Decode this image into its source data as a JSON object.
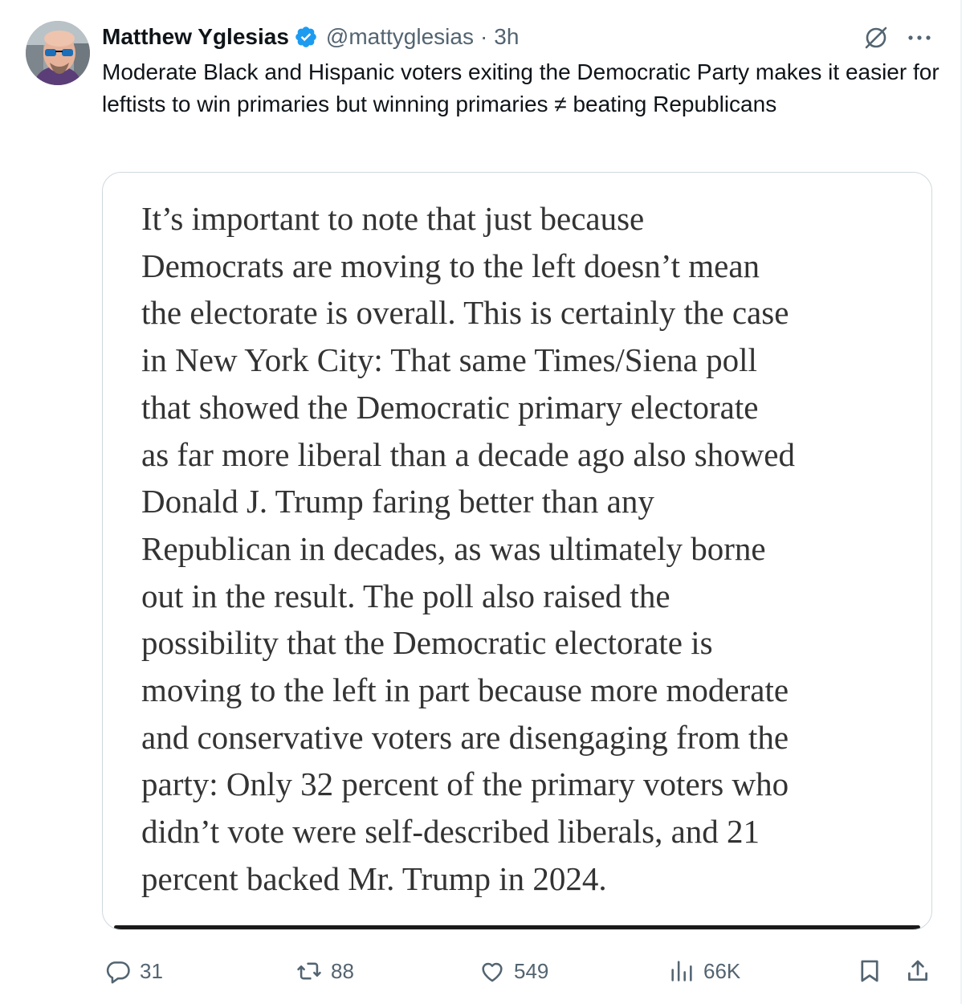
{
  "tweet": {
    "author": {
      "display_name": "Matthew Yglesias",
      "handle": "@mattyglesias",
      "verified": true,
      "avatar_icon": "avatar-photo"
    },
    "separator": "·",
    "time": "3h",
    "text": "Moderate Black and Hispanic voters exiting the Democratic Party makes it easier for leftists to win primaries but winning primaries ≠ beating Republicans",
    "media": {
      "quote_lines": [
        "It’s important to note that just because",
        "Democrats are moving to the left doesn’t mean",
        "the electorate is overall. This is certainly the case",
        "in New York City: That same Times/Siena poll",
        "that showed the Democratic primary electorate",
        "as far more liberal than a decade ago also showed",
        "Donald J. Trump faring better than any",
        "Republican in decades, as was ultimately borne",
        "out in the result. The poll also raised the",
        "possibility that the Democratic electorate is",
        "moving to the left in part because more moderate",
        "and conservative voters are disengaging from the",
        "party: Only 32 percent of the primary voters who",
        "didn’t vote were self-described liberals, and 21",
        "percent backed Mr. Trump in 2024."
      ]
    },
    "actions": {
      "replies": "31",
      "reposts": "88",
      "likes": "549",
      "views": "66K"
    }
  },
  "colors": {
    "text": "#0f1419",
    "secondary": "#536471",
    "verified": "#1d9bf0",
    "border": "#cfd9de",
    "quote_text": "#333333"
  },
  "icons": {
    "verified": "verified-badge-icon",
    "grok": "grok-icon",
    "more": "more-options-icon",
    "reply": "reply-icon",
    "repost": "repost-icon",
    "like": "heart-icon",
    "views": "views-chart-icon",
    "bookmark": "bookmark-icon",
    "share": "share-icon"
  }
}
